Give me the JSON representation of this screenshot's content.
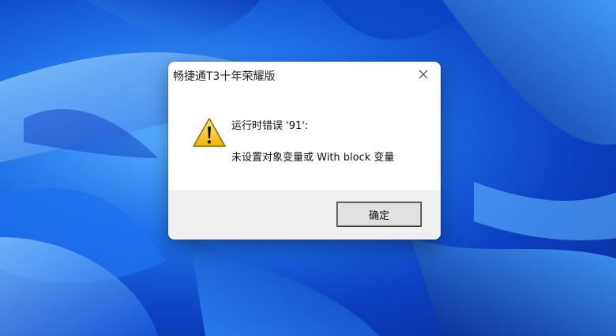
{
  "dialog": {
    "title": "畅捷通T3十年荣耀版",
    "message_line1": "运行时错误 '91':",
    "message_line2": "未设置对象变量或 With block 变量",
    "ok_label": "确定",
    "icon": "warning-icon",
    "close_icon": "close-icon"
  },
  "desktop": {
    "wallpaper": "windows-11-bloom-blue"
  }
}
